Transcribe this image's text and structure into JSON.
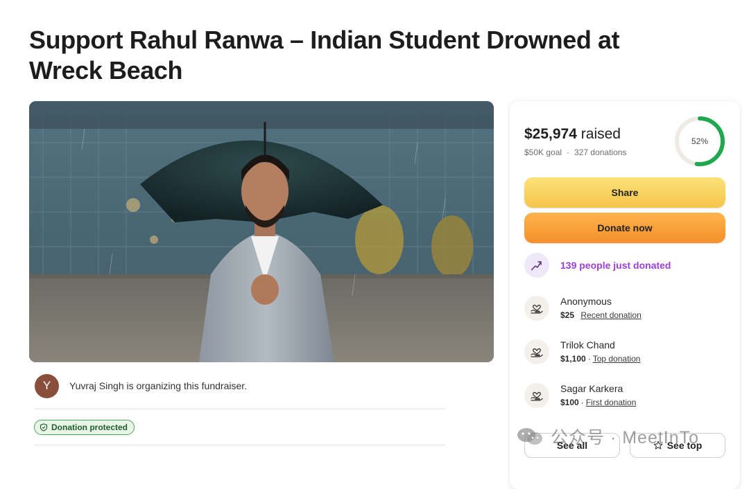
{
  "page": {
    "title": "Support Rahul Ranwa – Indian Student Drowned at Wreck Beach"
  },
  "hero": {
    "image": "man-with-umbrella-photo"
  },
  "organizer": {
    "avatar_letter": "Y",
    "text": "Yuvraj Singh is organizing this fundraiser.",
    "avatar_color": "#8a4f3b"
  },
  "badge": {
    "label": "Donation protected",
    "icon": "shield-icon",
    "color": "#4fa15e"
  },
  "stats": {
    "raised_amount": "$25,974",
    "raised_suffix": "raised",
    "goal": "$50K goal",
    "donations": "327 donations",
    "percent_label": "52%",
    "percent_value": 0.52,
    "ring_color": "#1fa84f"
  },
  "actions": {
    "share_label": "Share",
    "donate_label": "Donate now"
  },
  "trending": {
    "text": "139 people just donated",
    "icon": "trending-up-icon",
    "color": "#9d3ed6"
  },
  "donors": [
    {
      "name": "Anonymous",
      "amount": "$25",
      "tag": "Recent donation",
      "icon": "heart-hand-icon"
    },
    {
      "name": "Trilok Chand",
      "amount": "$1,100",
      "tag": "Top donation",
      "icon": "heart-hand-icon"
    },
    {
      "name": "Sagar Karkera",
      "amount": "$100",
      "tag": "First donation",
      "icon": "heart-hand-icon"
    }
  ],
  "footer_buttons": {
    "see_all": "See all",
    "see_top": "See top"
  },
  "watermark": {
    "text": "公众号 · MeetInTo"
  },
  "colors": {
    "share_button": "#f5c54a",
    "donate_button": "#f58f2a"
  }
}
